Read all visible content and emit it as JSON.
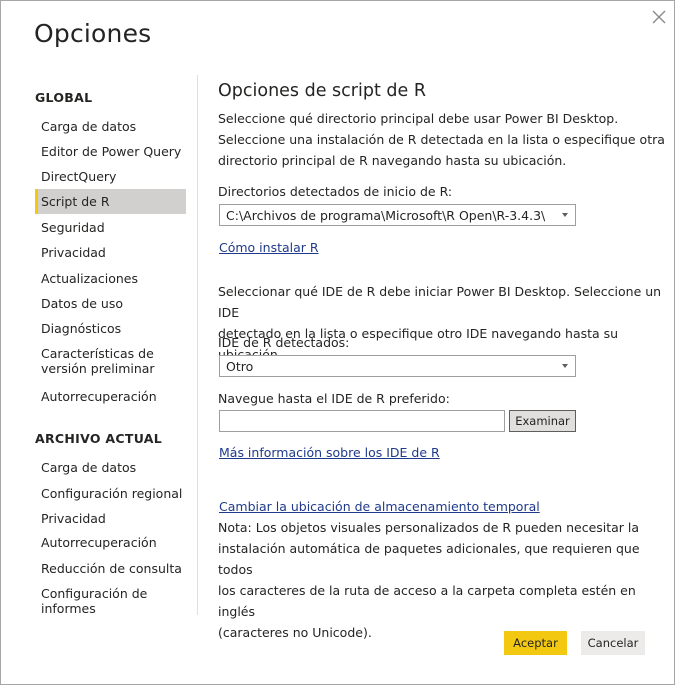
{
  "dialog": {
    "title": "Opciones",
    "close_icon": "close-icon"
  },
  "sidebar": {
    "global_heading": "GLOBAL",
    "global_items": [
      {
        "label": "Carga de datos"
      },
      {
        "label": "Editor de Power Query"
      },
      {
        "label": "DirectQuery"
      },
      {
        "label": "Script de R",
        "selected": true
      },
      {
        "label": "Seguridad"
      },
      {
        "label": "Privacidad"
      },
      {
        "label": "Actualizaciones"
      },
      {
        "label": "Datos de uso"
      },
      {
        "label": "Diagnósticos"
      },
      {
        "label": "Características de versión preliminar"
      },
      {
        "label": "Autorrecuperación"
      }
    ],
    "file_heading": "ARCHIVO ACTUAL",
    "file_items": [
      {
        "label": "Carga de datos"
      },
      {
        "label": "Configuración regional"
      },
      {
        "label": "Privacidad"
      },
      {
        "label": "Autorrecuperación"
      },
      {
        "label": "Reducción de consulta"
      },
      {
        "label": "Configuración de informes"
      }
    ]
  },
  "main": {
    "title": "Opciones de script de R",
    "intro_lines": [
      "Seleccione qué directorio principal debe usar Power BI Desktop.",
      "Seleccione una instalación de R detectada en la lista o especifique otra",
      "directorio principal de R navegando hasta su ubicación."
    ],
    "home_dirs_label": "Directorios detectados de inicio de R:",
    "home_dirs_value": "C:\\Archivos de programa\\Microsoft\\R Open\\R-3.4.3\\",
    "install_link": "Cómo instalar R",
    "ide_intro_lines": [
      "Seleccionar qué IDE de R debe iniciar Power BI Desktop. Seleccione un IDE",
      "detectado en la lista o especifique otro IDE navegando hasta su ubicación."
    ],
    "ide_label": "IDE de R detectados:",
    "ide_value": "Otro",
    "browse_label": "Navegue hasta el IDE de R preferido:",
    "browse_input_value": "",
    "browse_button": "Examinar",
    "ide_link": "Más información sobre los IDE de R",
    "temp_link": "Cambiar la ubicación de almacenamiento temporal",
    "note_lines": [
      "Nota: Los objetos visuales personalizados de R pueden necesitar la",
      "instalación automática de paquetes adicionales, que requieren que todos",
      "los caracteres de la ruta de acceso a la carpeta completa estén en inglés",
      "(caracteres no Unicode)."
    ]
  },
  "footer": {
    "ok_label": "Aceptar",
    "cancel_label": "Cancelar"
  },
  "colors": {
    "accent": "#f2c811",
    "selected_bg": "#d2d0ce",
    "link": "#1f3a8a"
  }
}
